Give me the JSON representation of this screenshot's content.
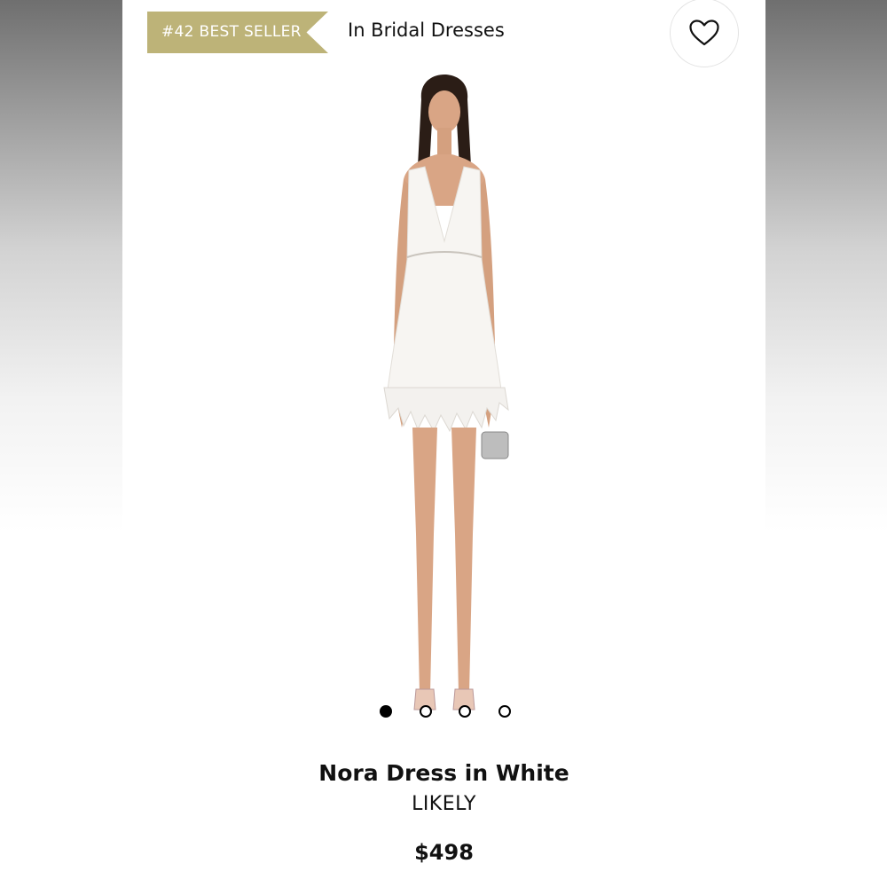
{
  "badge": {
    "text": "#42 BEST SELLER",
    "color": "#bdb378"
  },
  "category": "In Bridal Dresses",
  "favorite": {
    "icon": "heart-icon"
  },
  "carousel": {
    "total": 4,
    "active": 1
  },
  "product": {
    "name": "Nora Dress in White",
    "brand": "LIKELY",
    "price": "$498"
  }
}
